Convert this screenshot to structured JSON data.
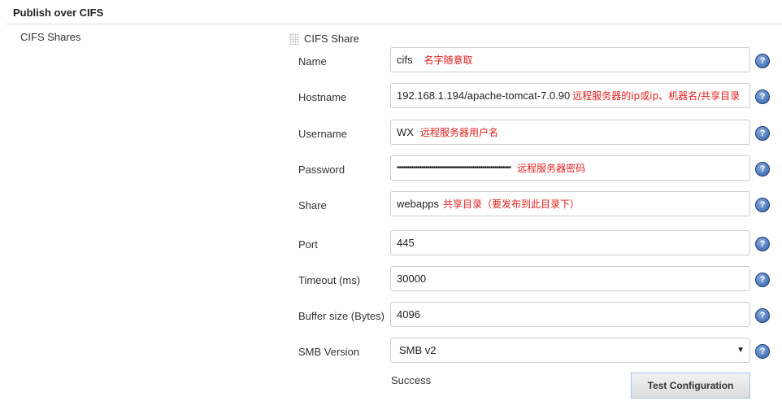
{
  "section": {
    "title": "Publish over CIFS"
  },
  "shares_label": "CIFS Shares",
  "share_header": "CIFS Share",
  "fields": [
    {
      "label": "Name",
      "value": "cifs",
      "note": "名字随意取"
    },
    {
      "label": "Hostname",
      "value": "192.168.1.194/apache-tomcat-7.0.90",
      "note": "远程服务器的ip或ip、机器名/共享目录"
    },
    {
      "label": "Username",
      "value": "WX",
      "note": "远程服务器用户名"
    },
    {
      "label": "Password",
      "value": "••••••••••••••••••••••••••••••••••••••••••••••••••••••••",
      "note": "远程服务器密码"
    },
    {
      "label": "Share",
      "value": "webapps",
      "note": "共享目录（要发布到此目录下）"
    },
    {
      "label": "Port",
      "value": "445"
    },
    {
      "label": "Timeout (ms)",
      "value": "30000"
    },
    {
      "label": "Buffer size (Bytes)",
      "value": "4096"
    },
    {
      "label": "SMB Version",
      "value": "SMB v2"
    }
  ],
  "status": "Success",
  "test_button": "Test Configuration",
  "help_glyph": "?"
}
